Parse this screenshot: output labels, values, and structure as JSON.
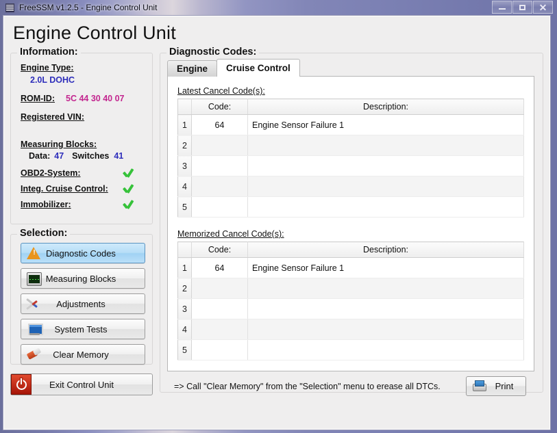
{
  "window": {
    "title": "FreeSSM v1.2.5 - Engine Control Unit",
    "icon": "app-icon",
    "minimize_label": "–",
    "maximize_label": "□",
    "close_label": "✕"
  },
  "page_title": "Engine Control Unit",
  "information": {
    "legend": "Information:",
    "engine_type_label": "Engine Type:",
    "engine_type_value": "2.0L DOHC",
    "rom_id_label": "ROM-ID:",
    "rom_id_value": "5C 44 30 40 07",
    "registered_vin_label": "Registered VIN:",
    "registered_vin_value": "",
    "measuring_blocks_label": "Measuring Blocks:",
    "data_label": "Data:",
    "data_value": "47",
    "switches_label": "Switches",
    "switches_value": "41",
    "indicators": [
      {
        "label": "OBD2-System:",
        "state": "check"
      },
      {
        "label": "Integ. Cruise Control:",
        "state": "check"
      },
      {
        "label": "Immobilizer:",
        "state": "check"
      }
    ]
  },
  "selection": {
    "legend": "Selection:",
    "buttons": [
      {
        "label": "Diagnostic Codes",
        "icon": "warning-triangle-icon",
        "active": true
      },
      {
        "label": "Measuring Blocks",
        "icon": "oscilloscope-icon",
        "active": false
      },
      {
        "label": "Adjustments",
        "icon": "tools-icon",
        "active": false
      },
      {
        "label": "System Tests",
        "icon": "monitor-icon",
        "active": false
      },
      {
        "label": "Clear Memory",
        "icon": "eraser-icon",
        "active": false
      }
    ],
    "exit_label": "Exit Control Unit",
    "exit_icon": "power-icon"
  },
  "diagnostic_codes": {
    "legend": "Diagnostic Codes:",
    "tabs": [
      {
        "label": "Engine",
        "active": false
      },
      {
        "label": "Cruise Control",
        "active": true
      }
    ],
    "latest": {
      "caption": "Latest Cancel Code(s):",
      "columns": [
        "",
        "Code:",
        "Description:"
      ],
      "rows": [
        {
          "index": "1",
          "code": "64",
          "description": "Engine Sensor Failure 1"
        },
        {
          "index": "2",
          "code": "",
          "description": ""
        },
        {
          "index": "3",
          "code": "",
          "description": ""
        },
        {
          "index": "4",
          "code": "",
          "description": ""
        },
        {
          "index": "5",
          "code": "",
          "description": ""
        }
      ]
    },
    "memorized": {
      "caption": "Memorized Cancel Code(s):",
      "columns": [
        "",
        "Code:",
        "Description:"
      ],
      "rows": [
        {
          "index": "1",
          "code": "64",
          "description": "Engine Sensor Failure 1"
        },
        {
          "index": "2",
          "code": "",
          "description": ""
        },
        {
          "index": "3",
          "code": "",
          "description": ""
        },
        {
          "index": "4",
          "code": "",
          "description": ""
        },
        {
          "index": "5",
          "code": "",
          "description": ""
        }
      ]
    }
  },
  "footer": {
    "hint": "=> Call \"Clear Memory\" from the \"Selection\" menu to erease all DTCs.",
    "print_label": "Print",
    "print_icon": "printer-icon"
  },
  "colors": {
    "accent_blue": "#2d2dbb",
    "accent_pink": "#c3268f",
    "check_green": "#36c23a",
    "active_button": "#a0d2f4",
    "exit_red": "#a61508"
  }
}
